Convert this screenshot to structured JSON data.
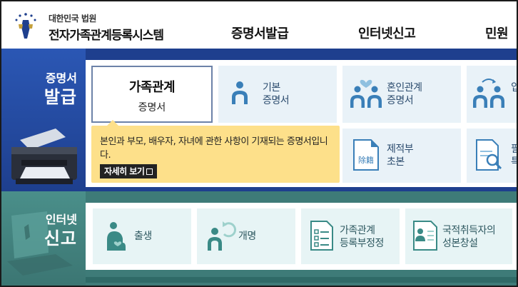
{
  "header": {
    "court_name": "대한민국 법원",
    "system_name": "전자가족관계등록시스템",
    "nav": [
      "증명서발급",
      "인터넷신고",
      "민원"
    ]
  },
  "certificate_section": {
    "title_line1": "증명서",
    "title_line2": "발급",
    "selected_tile": {
      "line1": "가족관계",
      "line2": "증명서"
    },
    "tiles": [
      {
        "line1": "기본",
        "line2": "증명서",
        "icon": "person-icon"
      },
      {
        "line1": "혼인관계",
        "line2": "증명서",
        "icon": "couple-heart-icon"
      },
      {
        "line1": "입",
        "line2": "",
        "icon": "family-adoption-icon"
      },
      {
        "line1": "제적부",
        "line2": "초본",
        "icon": "document-removed-register-icon",
        "icon_text": "除籍"
      },
      {
        "line1": "필",
        "line2": "특",
        "icon": "document-search-icon"
      }
    ],
    "tooltip": {
      "text": "본인과 부모, 배우자, 자녀에 관한 사항이 기재되는 증명서입니다.",
      "button_label": "자세히 보기"
    }
  },
  "report_section": {
    "title_line1": "인터넷",
    "title_line2": "신고",
    "tiles": [
      {
        "line1": "출생",
        "line2": "",
        "icon": "birth-mother-icon"
      },
      {
        "line1": "개명",
        "line2": "",
        "icon": "person-refresh-icon"
      },
      {
        "line1": "가족관계",
        "line2": "등록부정정",
        "icon": "checklist-document-icon"
      },
      {
        "line1": "국적취득자의",
        "line2": "성본창설",
        "icon": "id-card-icon"
      }
    ]
  },
  "colors": {
    "cert_band": "#1e3f8e",
    "report_band": "#3e7b78",
    "tooltip_bg": "#fde08a",
    "tile_bg": "#e9f2f8",
    "icon_blue": "#3a7fb8"
  }
}
